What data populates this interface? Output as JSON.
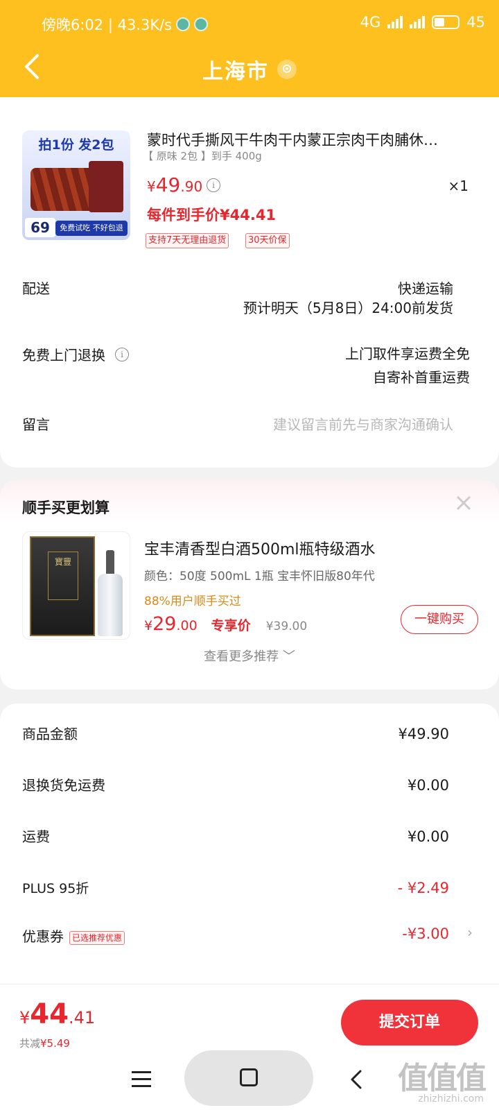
{
  "status_bar": {
    "left": "傍晚6:02 | 43.3K/s",
    "network": "4G",
    "battery": "45"
  },
  "header": {
    "city": "上海市"
  },
  "product": {
    "thumb_top": "拍1份 发2包",
    "thumb_price": "69",
    "thumb_free": "免费试吃 不好包退",
    "title": "蒙时代手撕风干牛肉干内蒙正宗肉干肉脯休…",
    "spec": "【 原味 2包 】到手 400g",
    "price_cur": "¥",
    "price_int": "49",
    "price_dec": ".90",
    "qty": "×1",
    "unit_price": "每件到手价¥44.41",
    "tags": [
      "支持7天无理由退货",
      "30天价保"
    ]
  },
  "delivery": {
    "label": "配送",
    "method": "快递运输",
    "eta": "预计明天（5月8日）24:00前发货"
  },
  "returns": {
    "label": "免费上门退换",
    "line1": "上门取件享运费全免",
    "line2": "自寄补首重运费"
  },
  "message": {
    "label": "留言",
    "placeholder": "建议留言前先与商家沟通确认"
  },
  "recommend": {
    "title": "顺手买更划算",
    "box_text": "寳豐",
    "name": "宝丰清香型白酒500ml瓶特级酒水",
    "spec": "颜色：50度 500mL 1瓶 宝丰怀旧版80年代",
    "social": "88%用户顺手买过",
    "price_cur": "¥",
    "price_int": "29",
    "price_dec": ".00",
    "exclusive": "专享价",
    "orig_price": "¥39.00",
    "buy_label": "一键购买",
    "more_label": "查看更多推荐 ﹀"
  },
  "summary": {
    "rows": [
      {
        "label": "商品金额",
        "value": "¥49.90"
      },
      {
        "label": "退换货免运费",
        "value": "¥0.00"
      },
      {
        "label": "运费",
        "value": "¥0.00"
      },
      {
        "label": "PLUS 95折",
        "value": "- ¥2.49"
      },
      {
        "label": "优惠券",
        "value": "-¥3.00"
      }
    ],
    "coupon_tag": "已选推荐优惠"
  },
  "bottom": {
    "total_cur": "¥",
    "total_int": "44",
    "total_dec": ".41",
    "saved_label": "共减",
    "saved_value": "¥5.49",
    "submit_label": "提交订单"
  },
  "watermark": {
    "logo": "值值值",
    "url": "zhizhizhi.com"
  },
  "colors": {
    "brand_yellow": "#fec01f",
    "price_red": "#e8262d",
    "submit_red": "#f0323a"
  }
}
